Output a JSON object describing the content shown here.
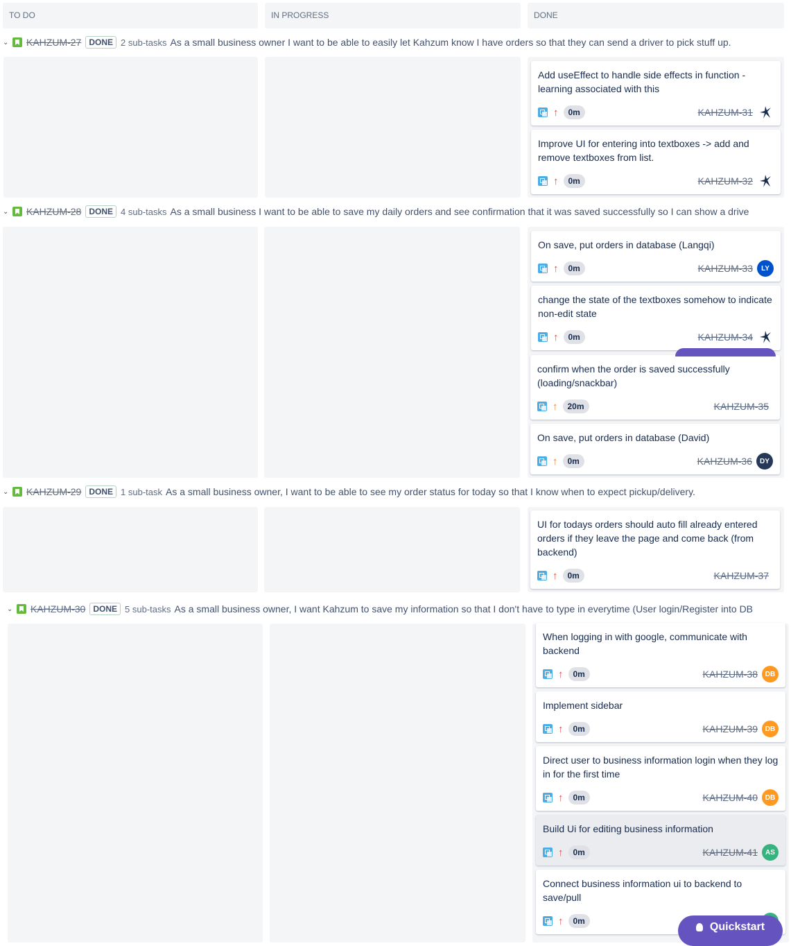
{
  "columns": [
    "TO DO",
    "IN PROGRESS",
    "DONE"
  ],
  "swimlanes": [
    {
      "key": "KAHZUM-27",
      "status": "DONE",
      "subtasks": "2 sub-tasks",
      "summary": "As a small business owner I want to be able to easily let Kahzum know I have orders so that they can send a driver to pick stuff up."
    },
    {
      "key": "KAHZUM-28",
      "status": "DONE",
      "subtasks": "4 sub-tasks",
      "summary": "As a small business I want to be able to save my daily orders and see confirmation that it was saved successfully so I can show a drive"
    },
    {
      "key": "KAHZUM-29",
      "status": "DONE",
      "subtasks": "1 sub-task",
      "summary": "As a small business owner, I want to be able to see my order status for today so that I know when to expect pickup/delivery."
    },
    {
      "key": "KAHZUM-30",
      "status": "DONE",
      "subtasks": "5 sub-tasks",
      "summary": "As a small business owner, I want Kahzum to save my information so that I don't have to type in everytime (User login/Register into DB"
    }
  ],
  "cards": [
    {
      "title": "Add useEffect to handle side effects in function - learning associated with this",
      "priority": "high",
      "estimate": "0m",
      "key": "KAHZUM-31",
      "avatar": {
        "type": "image",
        "name": "figure-avatar-icon"
      }
    },
    {
      "title": "Improve UI for entering into textboxes -> add and remove textboxes from list.",
      "priority": "high",
      "estimate": "0m",
      "key": "KAHZUM-32",
      "avatar": {
        "type": "image",
        "name": "figure-avatar-icon"
      }
    },
    {
      "title": "On save, put orders in database (Langqi)",
      "priority": "high",
      "estimate": "0m",
      "key": "KAHZUM-33",
      "avatar": {
        "type": "initials",
        "initials": "LY",
        "color": "#0052cc"
      }
    },
    {
      "title": "change the state of the textboxes somehow to indicate non-edit state",
      "priority": "high",
      "estimate": "0m",
      "key": "KAHZUM-34",
      "avatar": {
        "type": "image",
        "name": "figure-avatar-icon"
      }
    },
    {
      "title": "confirm when the order is saved successfully (loading/snackbar)",
      "priority": "medium",
      "estimate": "20m",
      "key": "KAHZUM-35",
      "avatar": null
    },
    {
      "title": "On save, put orders in database (David)",
      "priority": "medium",
      "estimate": "0m",
      "key": "KAHZUM-36",
      "avatar": {
        "type": "initials",
        "initials": "DY",
        "color": "#253858"
      }
    },
    {
      "title": "UI for todays orders should auto fill already entered orders if they leave the page and come back (from backend)",
      "priority": "high",
      "estimate": "0m",
      "key": "KAHZUM-37",
      "avatar": null
    },
    {
      "title": "When logging in with google, communicate with backend",
      "priority": "high",
      "estimate": "0m",
      "key": "KAHZUM-38",
      "avatar": {
        "type": "initials",
        "initials": "DB",
        "color": "#ff991f"
      }
    },
    {
      "title": "Implement sidebar",
      "priority": "high",
      "estimate": "0m",
      "key": "KAHZUM-39",
      "avatar": {
        "type": "initials",
        "initials": "DB",
        "color": "#ff991f"
      }
    },
    {
      "title": "Direct user to business information login when they log in for the first time",
      "priority": "high",
      "estimate": "0m",
      "key": "KAHZUM-40",
      "avatar": {
        "type": "initials",
        "initials": "DB",
        "color": "#ff991f"
      }
    },
    {
      "title": "Build Ui for editing business information",
      "priority": "high",
      "estimate": "0m",
      "key": "KAHZUM-41",
      "avatar": {
        "type": "initials",
        "initials": "AS",
        "color": "#36b37e"
      }
    },
    {
      "title": "Connect business information ui to backend to save/pull",
      "priority": "high",
      "estimate": "0m",
      "key": "",
      "avatar": {
        "type": "initials",
        "initials": "",
        "color": "#36b37e"
      }
    }
  ],
  "quickstart_label": "Quickstart",
  "icons": {
    "chevron": "chevron-down-icon",
    "story": "story-icon",
    "subtask": "subtask-icon",
    "priority": "arrow-up-icon",
    "lightbulb": "lightbulb-icon"
  }
}
